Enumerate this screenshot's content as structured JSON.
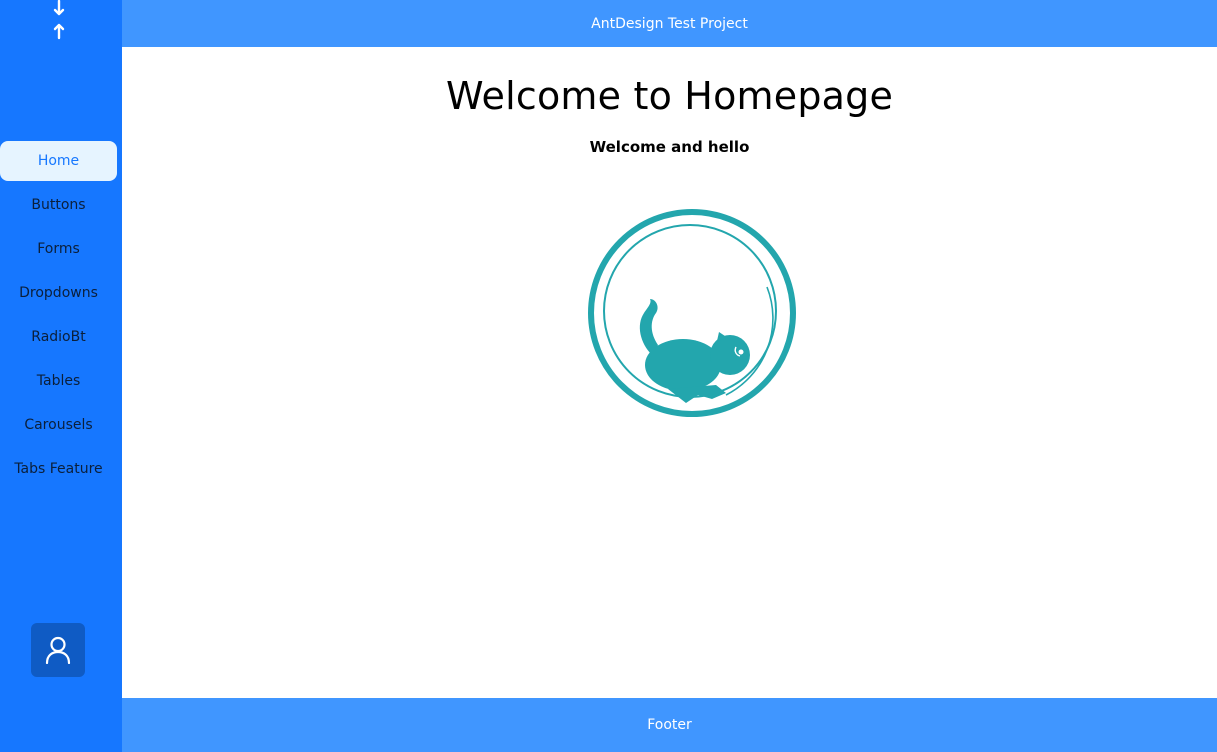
{
  "header": {
    "title": "AntDesign Test Project"
  },
  "sidebar": {
    "toggle_icon": "sort-arrows-icon",
    "items": [
      {
        "label": "Home",
        "active": true
      },
      {
        "label": "Buttons",
        "active": false
      },
      {
        "label": "Forms",
        "active": false
      },
      {
        "label": "Dropdowns",
        "active": false
      },
      {
        "label": "RadioBt",
        "active": false
      },
      {
        "label": "Tables",
        "active": false
      },
      {
        "label": "Carousels",
        "active": false
      },
      {
        "label": "Tabs Feature",
        "active": false
      }
    ],
    "user_icon": "user-icon"
  },
  "main": {
    "title": "Welcome to Homepage",
    "subtitle": "Welcome and hello",
    "logo_icon": "cat-in-wheel-logo"
  },
  "footer": {
    "text": "Footer"
  },
  "colors": {
    "sidebar_bg": "#1677ff",
    "header_bg": "#4096ff",
    "active_item_bg": "#e6f4ff",
    "active_item_text": "#1677ff",
    "logo_teal": "#23a6ad"
  }
}
